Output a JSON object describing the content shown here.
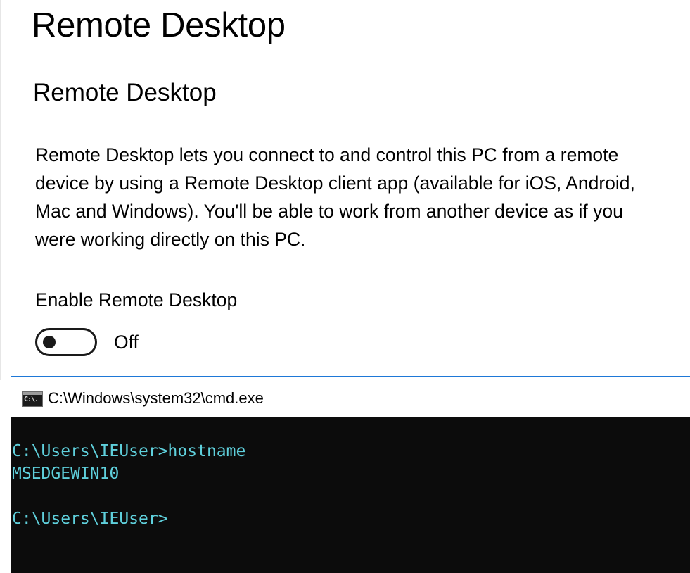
{
  "settings": {
    "page_title": "Remote Desktop",
    "section_title": "Remote Desktop",
    "description": "Remote Desktop lets you connect to and control this PC from a remote device by using a Remote Desktop client app (available for iOS, Android, Mac and Windows). You'll be able to work from another device as if you were working directly on this PC.",
    "toggle": {
      "label": "Enable Remote Desktop",
      "state_text": "Off",
      "on": false
    }
  },
  "cmd": {
    "title": "C:\\Windows\\system32\\cmd.exe",
    "icon": "cmd-icon",
    "icon_text": "C:\\.",
    "lines": [
      "C:\\Users\\IEUser>hostname",
      "MSEDGEWIN10",
      "",
      "C:\\Users\\IEUser>"
    ],
    "text_color": "#5fd0dc",
    "background_color": "#0c0c0c"
  },
  "colors": {
    "accent_border": "#1e78d7",
    "toggle_off": "#1a1a1a"
  }
}
